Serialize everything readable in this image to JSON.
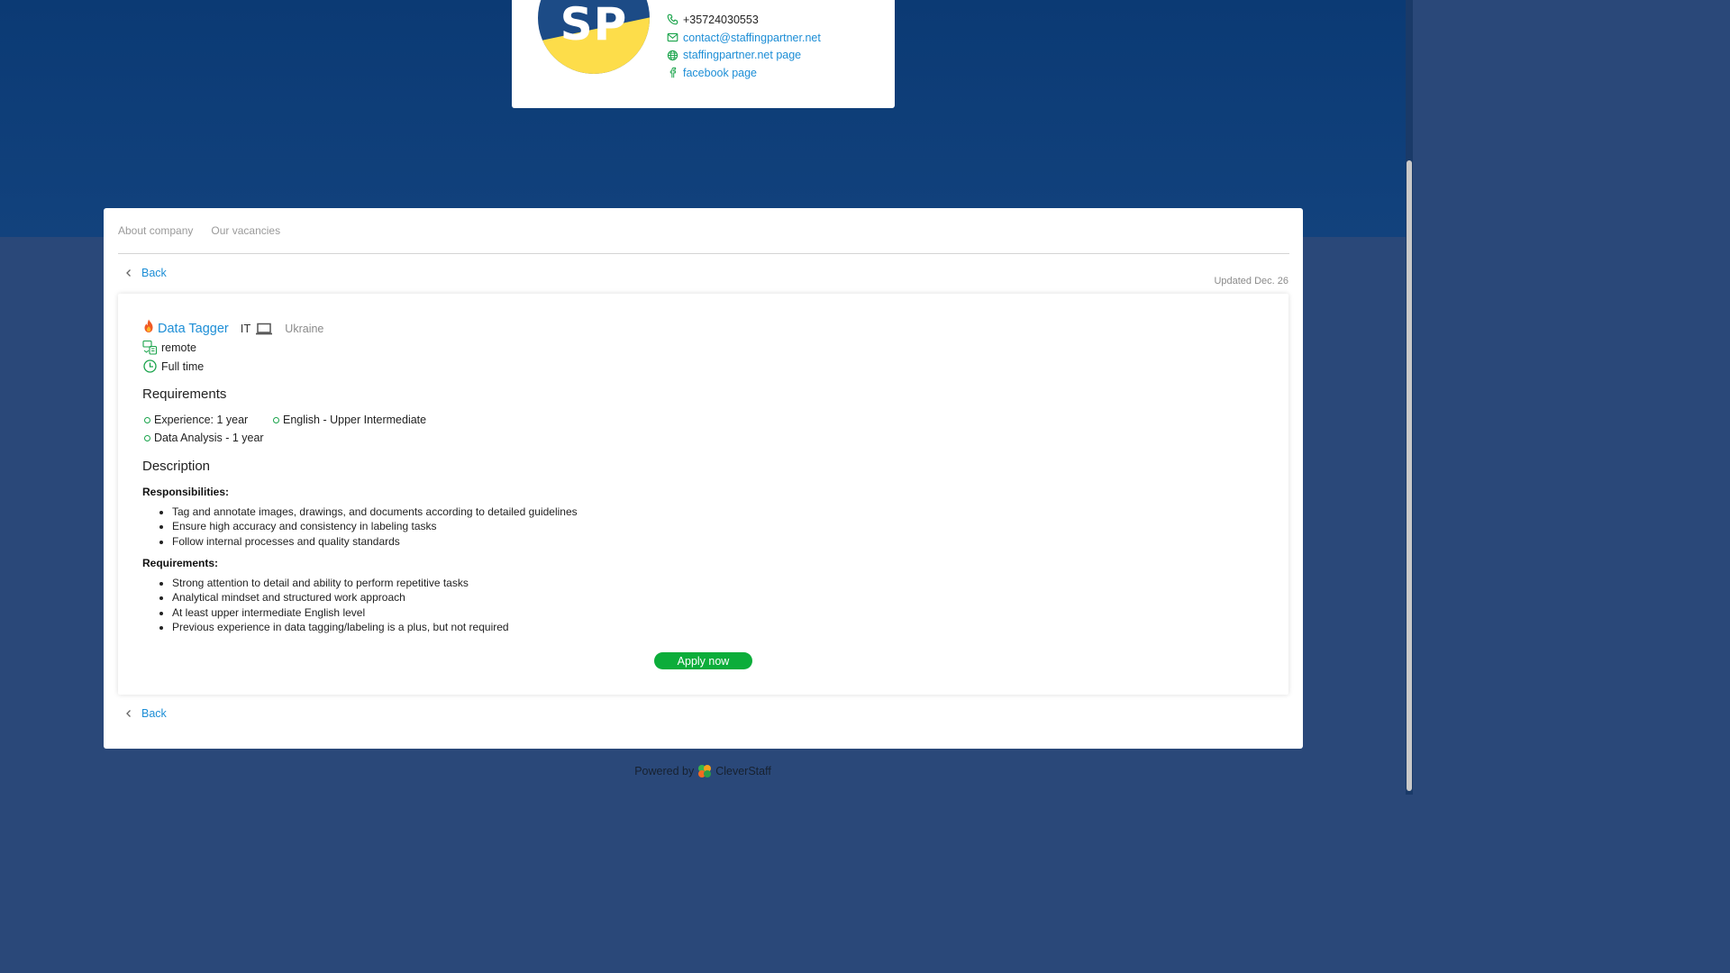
{
  "company": {
    "logo_text": "SP",
    "phone": "+35724030553",
    "email": "contact@staffingpartner.net",
    "website": "staffingpartner.net page",
    "facebook": "facebook page"
  },
  "tabs": [
    "About company",
    "Our vacancies"
  ],
  "back_label": "Back",
  "updated": "Updated Dec. 26",
  "vacancy": {
    "title": "Data Tagger",
    "category": "IT",
    "location": "Ukraine",
    "work_format": "remote",
    "employment": "Full time",
    "requirements_heading": "Requirements",
    "requirements": [
      "Experience: 1 year",
      "English - Upper Intermediate",
      "Data Analysis - 1 year"
    ],
    "description_heading": "Description",
    "responsibilities_heading": "Responsibilities:",
    "responsibilities": [
      "Tag and annotate images, drawings, and documents according to detailed guidelines",
      "Ensure high accuracy and consistency in labeling tasks",
      "Follow internal processes and quality standards"
    ],
    "requirements_sub_heading": "Requirements:",
    "requirement_list": [
      "Strong attention to detail and ability to perform repetitive tasks",
      "Analytical mindset and structured work approach",
      "At least upper intermediate English level",
      "Previous experience in data tagging/labeling is a plus, but not required"
    ],
    "apply_label": "Apply now"
  },
  "footer": {
    "powered_by": "Powered by",
    "brand": "CleverStaff"
  },
  "colors": {
    "hero_bg": "#0b3a74",
    "page_bg": "#2a4879",
    "link": "#1d8ed6",
    "accent_green": "#0cad3a",
    "logo_yellow": "#fddd4a"
  }
}
